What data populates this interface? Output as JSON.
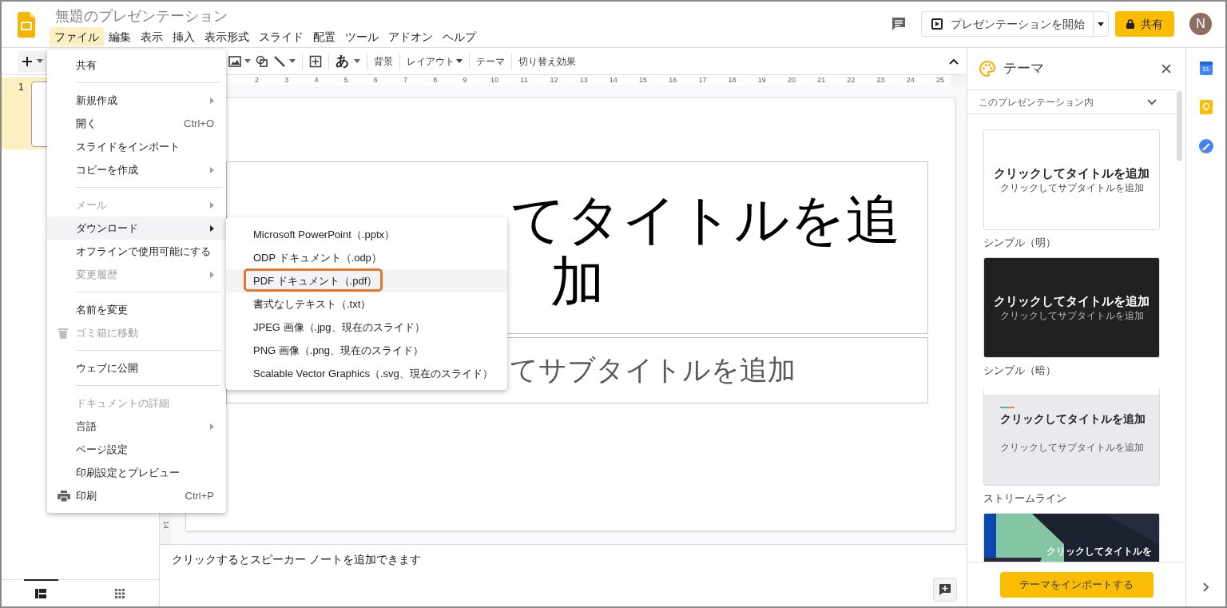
{
  "doc_title": "無題のプレゼンテーション",
  "menubar": [
    {
      "label": "ファイル",
      "selected": true
    },
    {
      "label": "編集",
      "selected": false
    },
    {
      "label": "表示",
      "selected": false
    },
    {
      "label": "挿入",
      "selected": false
    },
    {
      "label": "表示形式",
      "selected": false
    },
    {
      "label": "スライド",
      "selected": false
    },
    {
      "label": "配置",
      "selected": false
    },
    {
      "label": "ツール",
      "selected": false
    },
    {
      "label": "アドオン",
      "selected": false
    },
    {
      "label": "ヘルプ",
      "selected": false
    }
  ],
  "header_actions": {
    "present_button": "プレゼンテーションを開始",
    "share_button": "共有",
    "avatar": "N"
  },
  "toolbar": {
    "glyph": "あ",
    "buttons": [
      {
        "label": "背景",
        "caret": false
      },
      {
        "label": "レイアウト",
        "caret": true
      },
      {
        "label": "テーマ",
        "caret": false
      },
      {
        "label": "切り替え効果",
        "caret": false
      }
    ]
  },
  "ruler": [
    "2",
    "3",
    "4",
    "5",
    "6",
    "7",
    "8",
    "9",
    "10",
    "11",
    "12",
    "13",
    "14",
    "15",
    "16",
    "17",
    "18",
    "19",
    "20",
    "21",
    "22",
    "23",
    "24",
    "25"
  ],
  "vertical_ruler_label": "14",
  "filmstrip": {
    "slides": [
      {
        "number": "1",
        "selected": true
      }
    ],
    "views": [
      {
        "kind": "list",
        "selected": true
      },
      {
        "kind": "grid",
        "selected": false
      }
    ]
  },
  "slide": {
    "title_lines": [
      "てタイトルを追",
      "加"
    ],
    "subtitle": "てサブタイトルを追加"
  },
  "notes": {
    "placeholder": "クリックするとスピーカー ノートを追加できます"
  },
  "file_menu": [
    {
      "kind": "item",
      "label": "共有",
      "disabled": false,
      "submenu": false,
      "selected": false
    },
    {
      "kind": "separator"
    },
    {
      "kind": "item",
      "label": "新規作成",
      "disabled": false,
      "submenu": true,
      "selected": false
    },
    {
      "kind": "item",
      "label": "開く",
      "shortcut": "Ctrl+O",
      "disabled": false,
      "submenu": false,
      "selected": false
    },
    {
      "kind": "item",
      "label": "スライドをインポート",
      "disabled": false,
      "submenu": false,
      "selected": false
    },
    {
      "kind": "item",
      "label": "コピーを作成",
      "disabled": false,
      "submenu": true,
      "selected": false
    },
    {
      "kind": "separator"
    },
    {
      "kind": "item",
      "label": "メール",
      "disabled": true,
      "submenu": true,
      "selected": false
    },
    {
      "kind": "item",
      "label": "ダウンロード",
      "disabled": false,
      "submenu": true,
      "selected": true
    },
    {
      "kind": "item",
      "label": "オフラインで使用可能にする",
      "disabled": false,
      "submenu": false,
      "selected": false
    },
    {
      "kind": "item",
      "label": "変更履歴",
      "disabled": true,
      "submenu": true,
      "selected": false
    },
    {
      "kind": "separator"
    },
    {
      "kind": "item",
      "label": "名前を変更",
      "disabled": false,
      "submenu": false,
      "selected": false
    },
    {
      "kind": "trash_item",
      "label": "ゴミ箱に移動",
      "disabled": true,
      "submenu": false,
      "selected": false
    },
    {
      "kind": "separator"
    },
    {
      "kind": "item",
      "label": "ウェブに公開",
      "disabled": false,
      "submenu": false,
      "selected": false
    },
    {
      "kind": "separator"
    },
    {
      "kind": "item",
      "label": "ドキュメントの詳細",
      "disabled": true,
      "submenu": false,
      "selected": false
    },
    {
      "kind": "item",
      "label": "言語",
      "disabled": false,
      "submenu": true,
      "selected": false
    },
    {
      "kind": "item",
      "label": "ページ設定",
      "disabled": false,
      "submenu": false,
      "selected": false
    },
    {
      "kind": "item",
      "label": "印刷設定とプレビュー",
      "disabled": false,
      "submenu": false,
      "selected": false
    },
    {
      "kind": "print_item",
      "label": "印刷",
      "shortcut": "Ctrl+P",
      "disabled": false,
      "submenu": false,
      "selected": false
    }
  ],
  "download_submenu": [
    {
      "label": "Microsoft PowerPoint（.pptx）",
      "selected": false,
      "outlined": false
    },
    {
      "label": "ODP ドキュメント（.odp）",
      "selected": false,
      "outlined": false
    },
    {
      "label": "PDF ドキュメント（.pdf）",
      "selected": true,
      "outlined": true
    },
    {
      "label": "書式なしテキスト（.txt）",
      "selected": false,
      "outlined": false
    },
    {
      "label": "JPEG 画像（.jpg、現在のスライド）",
      "selected": false,
      "outlined": false
    },
    {
      "label": "PNG 画像（.png、現在のスライド）",
      "selected": false,
      "outlined": false
    },
    {
      "label": "Scalable Vector Graphics（.svg、現在のスライド）",
      "selected": false,
      "outlined": false
    }
  ],
  "theme_panel": {
    "title": "テーマ",
    "filter": "このプレゼンテーション内",
    "themes": [
      {
        "kind": "light",
        "title": "クリックしてタイトルを追加",
        "subtitle": "クリックしてサブタイトルを追加",
        "label": "シンプル（明）"
      },
      {
        "kind": "dark",
        "title": "クリックしてタイトルを追加",
        "subtitle": "クリックしてサブタイトルを追加",
        "label": "シンプル（暗）"
      },
      {
        "kind": "streamline",
        "title": "クリックしてタイトルを追加",
        "subtitle": "クリックしてサブタイトルを追加",
        "label": "ストリームライン"
      },
      {
        "kind": "focus",
        "title": "クリックしてタイトルを"
      }
    ],
    "import_button": "テーマをインポートする"
  },
  "side_apps": [
    {
      "kind": "calendar",
      "text": "31"
    },
    {
      "kind": "keep"
    },
    {
      "kind": "tasks"
    }
  ]
}
